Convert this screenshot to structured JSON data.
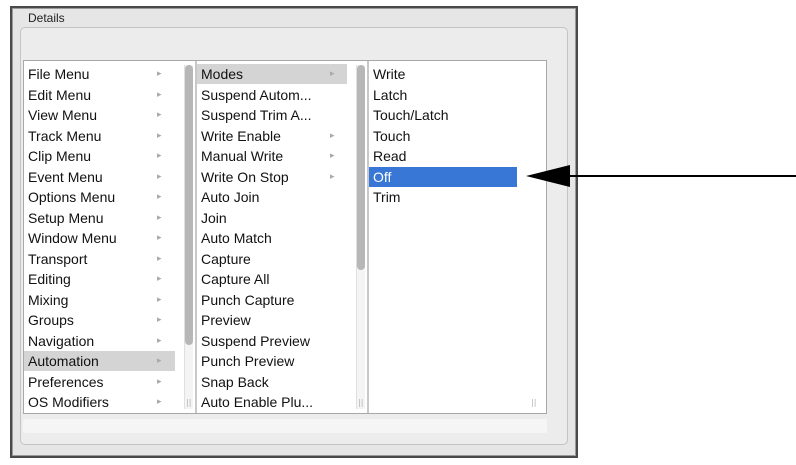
{
  "window": {
    "title": "Details"
  },
  "columns": [
    {
      "items": [
        {
          "label": "File Menu",
          "has_submenu": true,
          "selected": false
        },
        {
          "label": "Edit Menu",
          "has_submenu": true,
          "selected": false
        },
        {
          "label": "View Menu",
          "has_submenu": true,
          "selected": false
        },
        {
          "label": "Track Menu",
          "has_submenu": true,
          "selected": false
        },
        {
          "label": "Clip Menu",
          "has_submenu": true,
          "selected": false
        },
        {
          "label": "Event Menu",
          "has_submenu": true,
          "selected": false
        },
        {
          "label": "Options Menu",
          "has_submenu": true,
          "selected": false
        },
        {
          "label": "Setup Menu",
          "has_submenu": true,
          "selected": false
        },
        {
          "label": "Window Menu",
          "has_submenu": true,
          "selected": false
        },
        {
          "label": "Transport",
          "has_submenu": true,
          "selected": false
        },
        {
          "label": "Editing",
          "has_submenu": true,
          "selected": false
        },
        {
          "label": "Mixing",
          "has_submenu": true,
          "selected": false
        },
        {
          "label": "Groups",
          "has_submenu": true,
          "selected": false
        },
        {
          "label": "Navigation",
          "has_submenu": true,
          "selected": false
        },
        {
          "label": "Automation",
          "has_submenu": true,
          "selected": true
        },
        {
          "label": "Preferences",
          "has_submenu": true,
          "selected": false
        },
        {
          "label": "OS Modifiers",
          "has_submenu": true,
          "selected": false
        }
      ]
    },
    {
      "items": [
        {
          "label": "Modes",
          "has_submenu": true,
          "selected": true
        },
        {
          "label": "Suspend Autom...",
          "has_submenu": false,
          "selected": false
        },
        {
          "label": "Suspend Trim A...",
          "has_submenu": false,
          "selected": false
        },
        {
          "label": "Write Enable",
          "has_submenu": true,
          "selected": false
        },
        {
          "label": "Manual Write",
          "has_submenu": true,
          "selected": false
        },
        {
          "label": "Write On Stop",
          "has_submenu": true,
          "selected": false
        },
        {
          "label": "Auto Join",
          "has_submenu": false,
          "selected": false
        },
        {
          "label": "Join",
          "has_submenu": false,
          "selected": false
        },
        {
          "label": "Auto Match",
          "has_submenu": false,
          "selected": false
        },
        {
          "label": "Capture",
          "has_submenu": false,
          "selected": false
        },
        {
          "label": "Capture All",
          "has_submenu": false,
          "selected": false
        },
        {
          "label": "Punch Capture",
          "has_submenu": false,
          "selected": false
        },
        {
          "label": "Preview",
          "has_submenu": false,
          "selected": false
        },
        {
          "label": "Suspend Preview",
          "has_submenu": false,
          "selected": false
        },
        {
          "label": "Punch Preview",
          "has_submenu": false,
          "selected": false
        },
        {
          "label": "Snap Back",
          "has_submenu": false,
          "selected": false
        },
        {
          "label": "Auto Enable Plu...",
          "has_submenu": false,
          "selected": false
        }
      ]
    },
    {
      "items": [
        {
          "label": "Write",
          "has_submenu": false,
          "selected": false
        },
        {
          "label": "Latch",
          "has_submenu": false,
          "selected": false
        },
        {
          "label": "Touch/Latch",
          "has_submenu": false,
          "selected": false
        },
        {
          "label": "Touch",
          "has_submenu": false,
          "selected": false
        },
        {
          "label": "Read",
          "has_submenu": false,
          "selected": false
        },
        {
          "label": "Off",
          "has_submenu": false,
          "selected": true
        },
        {
          "label": "Trim",
          "has_submenu": false,
          "selected": false
        }
      ]
    }
  ],
  "colors": {
    "selection_active": "#3877d6",
    "selection_inactive": "#d4d4d4",
    "arrow": "#000000"
  },
  "icons": {
    "submenu": "chevron-right-icon",
    "resize_grip": "column-resize-grip-icon",
    "annotation": "arrow-left-icon"
  }
}
